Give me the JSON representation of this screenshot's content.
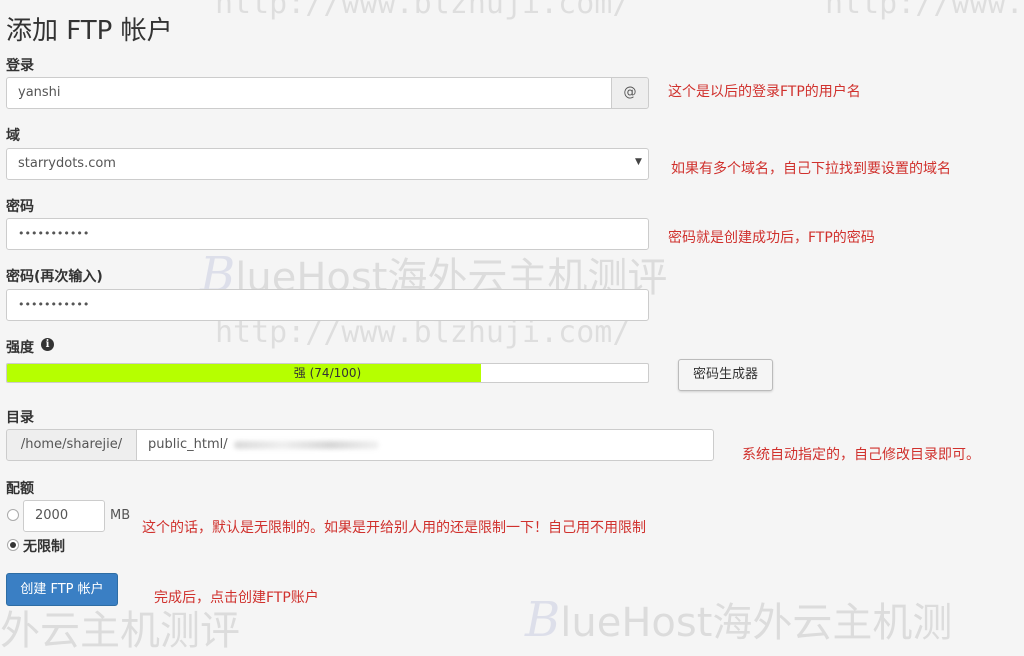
{
  "page": {
    "title": "添加 FTP 帐户"
  },
  "watermarks": {
    "url": "http://www.blzhuji.com/",
    "brand_letter": "B",
    "brand_rest": "lueHost海外云主机测评",
    "brand_cut_left": "外云主机测评",
    "brand_cut_right": "lueHost海外云主机测"
  },
  "login": {
    "label": "登录",
    "value": "yanshi",
    "addon": "@",
    "note": "这个是以后的登录FTP的用户名"
  },
  "domain": {
    "label": "域",
    "selected": "starrydots.com",
    "note": "如果有多个域名，自己下拉找到要设置的域名"
  },
  "password": {
    "label": "密码",
    "value": "•••••••••••",
    "note": "密码就是创建成功后，FTP的密码"
  },
  "password_confirm": {
    "label": "密码(再次输入)",
    "value": "•••••••••••"
  },
  "strength": {
    "label": "强度",
    "info_icon": "i",
    "text": "强 (74/100)",
    "percent": 74,
    "bar_color": "#b6ff00",
    "generator_button": "密码生成器"
  },
  "directory": {
    "label": "目录",
    "prefix": "/home/sharejie/",
    "value": "public_html/",
    "note": "系统自动指定的，自己修改目录即可。"
  },
  "quota": {
    "label": "配额",
    "value": "2000",
    "unit": "MB",
    "unlimited_label": "无限制",
    "note": "这个的话，默认是无限制的。如果是开给别人用的还是限制一下！自己用不用限制"
  },
  "submit": {
    "label": "创建 FTP 帐户",
    "note": "完成后，点击创建FTP账户",
    "color": "#3a7fc4"
  },
  "colors": {
    "note": "#d0312d",
    "background": "#f5f5f5"
  }
}
